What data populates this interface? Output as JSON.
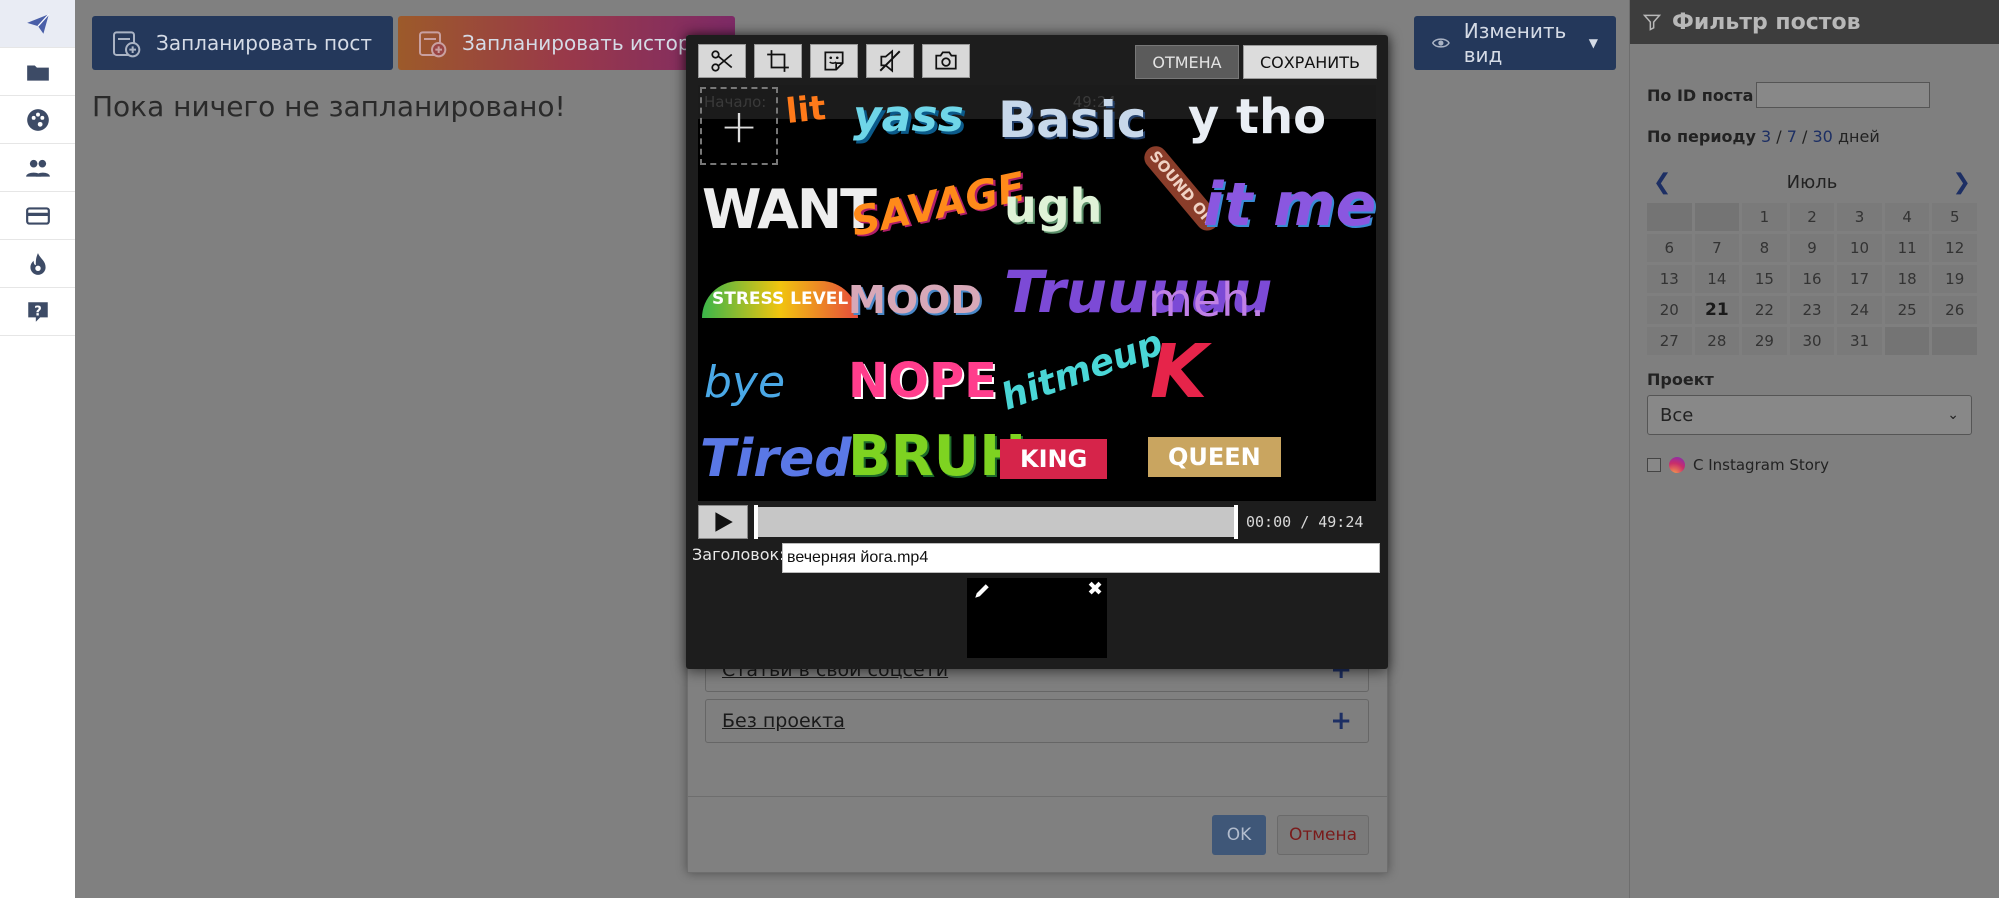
{
  "sidebar": {
    "items": [
      {
        "icon": "paper-plane-icon",
        "active": true
      },
      {
        "icon": "folder-icon"
      },
      {
        "icon": "palette-icon"
      },
      {
        "icon": "users-icon"
      },
      {
        "icon": "credit-card-icon"
      },
      {
        "icon": "fire-icon"
      },
      {
        "icon": "help-icon"
      }
    ]
  },
  "toolbar": {
    "plan_post_label": "Запланировать пост",
    "plan_story_label": "Запланировать истори",
    "change_view_label": "Изменить вид"
  },
  "main": {
    "empty_message": "Пока ничего не запланировано!"
  },
  "filter": {
    "title": "Фильтр постов",
    "post_id_label": "По ID поста",
    "period_label": "По периоду",
    "period_3": "3",
    "period_7": "7",
    "period_30": "30",
    "period_sep": "/",
    "period_unit": "дней",
    "month": "Июль",
    "calendar_days": [
      "",
      "",
      "1",
      "2",
      "3",
      "4",
      "5",
      "6",
      "7",
      "8",
      "9",
      "10",
      "11",
      "12",
      "13",
      "14",
      "15",
      "16",
      "17",
      "18",
      "19",
      "20",
      "21",
      "22",
      "23",
      "24",
      "25",
      "26",
      "27",
      "28",
      "29",
      "30",
      "31",
      "",
      ""
    ],
    "today": "21",
    "project_label": "Проект",
    "project_value": "Все",
    "story_checkbox_label": "С Instagram Story"
  },
  "under_dialog": {
    "rows": [
      {
        "label": "Статьи в свои соцсети",
        "plus": "+"
      },
      {
        "label": "Без проекта",
        "plus": "+"
      }
    ],
    "ok_label": "OK",
    "cancel_label": "Отмена"
  },
  "editor": {
    "cancel_label": "ОТМЕНА",
    "save_label": "СОХРАНИТЬ",
    "ghost_start": "Начало:",
    "ghost_end": "49:24",
    "add_sticker": "+",
    "time_current": "00:00",
    "time_total": "49:24",
    "time_separator": "/",
    "title_label": "Заголовок:",
    "title_value": "вечерняя йога.mp4",
    "stickers": [
      "lit",
      "yass",
      "Basic",
      "y tho",
      "WANT",
      "SAVAGE",
      "ugh",
      "SOUND ON",
      "it me",
      "STRESS LEVEL",
      "MOOD",
      "Truuuuu",
      "meh.",
      "bye",
      "NOPE",
      "hitmeup",
      "K",
      "Tired",
      "BRUH",
      "KING",
      "QUEEN"
    ]
  },
  "colors": {
    "brand_navy": "#24385b",
    "accent_blue": "#1d2f64",
    "editor_bg": "#1d1d1d"
  }
}
